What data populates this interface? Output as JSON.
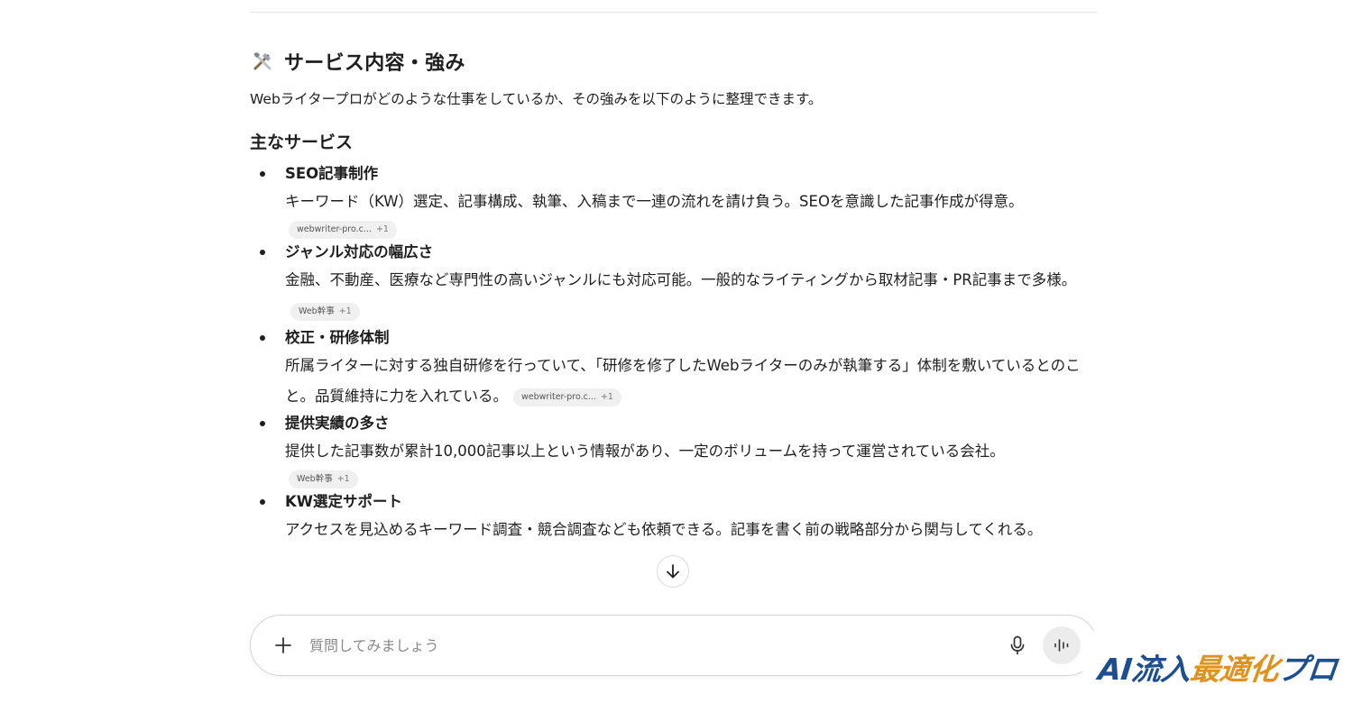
{
  "section": {
    "title": "サービス内容・強み",
    "icon": "tools-icon",
    "intro": "Webライタープロがどのような仕事をしているか、その強みを以下のように整理できます。"
  },
  "services_heading": "主なサービス",
  "services": [
    {
      "title": "SEO記事制作",
      "desc": "キーワード（KW）選定、記事構成、執筆、入稿まで一連の流れを請け負う。SEOを意識した記事作成が得意。",
      "chip": "webwriter-pro.c...",
      "chip_more": "+1"
    },
    {
      "title": "ジャンル対応の幅広さ",
      "desc": "金融、不動産、医療など専門性の高いジャンルにも対応可能。一般的なライティングから取材記事・PR記事まで多様。",
      "chip": "Web幹事",
      "chip_more": "+1"
    },
    {
      "title": "校正・研修体制",
      "desc": "所属ライターに対する独自研修を行っていて、「研修を修了したWebライターのみが執筆する」体制を敷いているとのこと。品質維持に力を入れている。",
      "chip": "webwriter-pro.c...",
      "chip_more": "+1"
    },
    {
      "title": "提供実績の多さ",
      "desc": "提供した記事数が累計10,000記事以上という情報があり、一定のボリュームを持って運営されている会社。",
      "chip": "Web幹事",
      "chip_more": "+1"
    },
    {
      "title": "KW選定サポート",
      "desc": "アクセスを見込めるキーワード調査・競合調査なども依頼できる。記事を書く前の戦略部分から関与してくれる。",
      "chip": "",
      "chip_more": ""
    }
  ],
  "composer": {
    "placeholder": "質問してみましょう",
    "plus_icon": "plus-icon",
    "mic_icon": "microphone-icon",
    "voice_icon": "voice-waveform-icon"
  },
  "scroll_button_icon": "arrow-down-icon",
  "watermark": {
    "part1": "AI流入",
    "part2": "最適化",
    "part3": "プロ"
  },
  "colors": {
    "watermark_blue": "#1d4e8f",
    "watermark_orange": "#e0921c",
    "chip_bg": "#f0f0f0"
  }
}
